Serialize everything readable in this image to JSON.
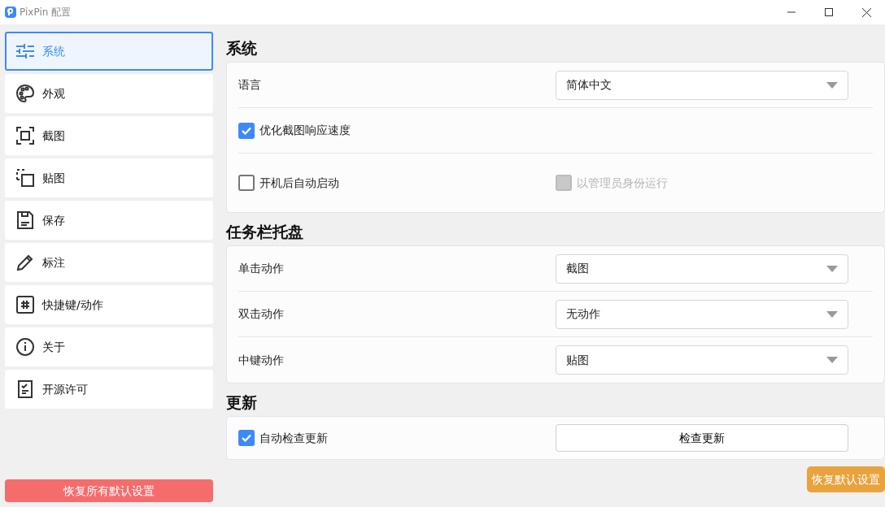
{
  "window": {
    "title": "PixPin 配置"
  },
  "sidebar": {
    "items": [
      {
        "label": "系统",
        "selected": true
      },
      {
        "label": "外观",
        "selected": false
      },
      {
        "label": "截图",
        "selected": false
      },
      {
        "label": "贴图",
        "selected": false
      },
      {
        "label": "保存",
        "selected": false
      },
      {
        "label": "标注",
        "selected": false
      },
      {
        "label": "快捷键/动作",
        "selected": false
      },
      {
        "label": "关于",
        "selected": false
      },
      {
        "label": "开源许可",
        "selected": false
      }
    ],
    "reset_all_button": "恢复所有默认设置"
  },
  "sections": [
    {
      "title": "系统",
      "rows": [
        {
          "kind": "select",
          "label": "语言",
          "value": "简体中文"
        },
        {
          "kind": "checks",
          "checks": [
            {
              "label": "优化截图响应速度",
              "checked": true,
              "disabled": false
            }
          ]
        },
        {
          "kind": "checks",
          "checks": [
            {
              "label": "开机后自动启动",
              "checked": false,
              "disabled": false
            },
            {
              "label": "以管理员身份运行",
              "checked": false,
              "disabled": true
            }
          ]
        }
      ]
    },
    {
      "title": "任务栏托盘",
      "rows": [
        {
          "kind": "select",
          "label": "单击动作",
          "value": "截图"
        },
        {
          "kind": "select",
          "label": "双击动作",
          "value": "无动作"
        },
        {
          "kind": "select",
          "label": "中键动作",
          "value": "贴图"
        }
      ]
    },
    {
      "title": "更新",
      "rows": [
        {
          "kind": "checks",
          "checks": [
            {
              "label": "自动检查更新",
              "checked": true,
              "disabled": false
            }
          ],
          "button": "检查更新"
        }
      ]
    }
  ],
  "reset_button": "恢复默认设置"
}
